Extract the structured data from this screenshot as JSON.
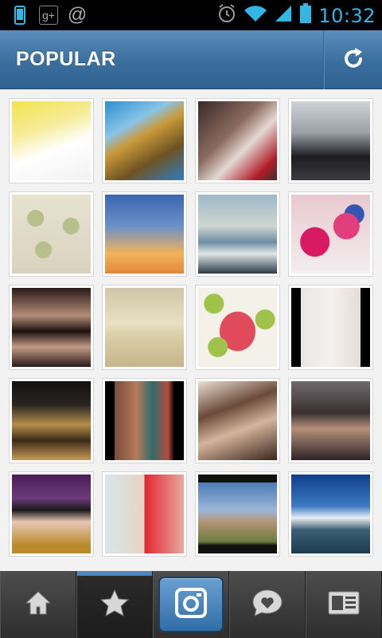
{
  "status_bar": {
    "time": "10:32",
    "icons": [
      "phone-icon",
      "google-plus-icon",
      "at-sign-icon",
      "alarm-icon",
      "wifi-icon",
      "signal-icon",
      "battery-icon"
    ],
    "g_plus_label": "g+",
    "at_label": "@"
  },
  "header": {
    "title": "POPULAR",
    "refresh_icon": "refresh-icon"
  },
  "colors": {
    "header_blue": "#3a6e9c",
    "status_accent": "#33b5e5",
    "active_tab_indicator": "#4a86c0"
  },
  "grid": {
    "photos": [
      {
        "name": "photo-cookie-and-cup",
        "bg": "linear-gradient(160deg,#f3e34a 0%,#f6ec9b 35%,#ffffff 60%,#f1f1f1 100%)"
      },
      {
        "name": "photo-rock-formation",
        "bg": "linear-gradient(150deg,#2b8fd0 0%,#8ac3e6 30%,#c99a3b 45%,#6f5322 70%,#2f7cc4 100%)"
      },
      {
        "name": "photo-two-girls-hugging",
        "bg": "linear-gradient(135deg,#3a2a27 0%,#8a6a5e 40%,#e3d8d2 60%,#b01c2a 85%,#3c2e2c 100%)"
      },
      {
        "name": "photo-three-boys",
        "bg": "linear-gradient(180deg,#cfd3d6 0%,#9aa0a6 40%,#1d1d21 70%,#3a3a3f 100%)"
      },
      {
        "name": "photo-polka-dot-phone",
        "bg": "radial-gradient(circle at 30% 30%,#b7c08a 0 10px,transparent 11px),radial-gradient(circle at 75% 40%,#b7c08a 0 10px,transparent 11px),radial-gradient(circle at 40% 70%,#b7c08a 0 10px,transparent 11px),linear-gradient(#e8e2d0,#d9d2bf)"
      },
      {
        "name": "photo-dandelion-sunset",
        "bg": "linear-gradient(180deg,#3866b0 0%,#6b90c9 40%,#f2b35a 75%,#e1863b 100%)"
      },
      {
        "name": "photo-pier-sunset",
        "bg": "linear-gradient(180deg,#9fb8c9 0%,#cfd6d0 40%,#6c8ea6 60%,#dfe5e6 75%,#2c3b47 100%)"
      },
      {
        "name": "photo-cake-pops",
        "bg": "radial-gradient(circle at 30% 60%,#d81a62 0 18px,transparent 19px),radial-gradient(circle at 70% 40%,#e23d7d 0 16px,transparent 17px),radial-gradient(circle at 80% 25%,#3556b0 0 12px,transparent 13px),linear-gradient(#e8c9cf,#f3eef0)"
      },
      {
        "name": "photo-woman-lying-1",
        "bg": "linear-gradient(180deg,#2b1a18 0%,#b48c78 35%,#1d1110 55%,#c49b86 75%,#2a1a18 100%)"
      },
      {
        "name": "photo-cloudy-field",
        "bg": "linear-gradient(180deg,#cfc7a7 0%,#e8e0c2 45%,#d9cfa8 60%,#c8b48a 100%)"
      },
      {
        "name": "photo-green-dots-pink",
        "bg": "radial-gradient(circle at 20% 20%,#9fc24a 0 12px,transparent 13px),radial-gradient(circle at 85% 40%,#9fc24a 0 12px,transparent 13px),radial-gradient(circle at 25% 75%,#9fc24a 0 12px,transparent 13px),radial-gradient(ellipse at 50% 55%,#e04a5a 0 22px,transparent 23px),linear-gradient(#f4f1e8,#f4f1e8)"
      },
      {
        "name": "photo-two-tattooed-women",
        "bg": "linear-gradient(90deg,#000 0%,#000 12%,#e9e6e3 12%,#f4f2f0 50%,#e4dcd5 88%,#000 88%,#000 100%)"
      },
      {
        "name": "photo-leopard-bag",
        "bg": "linear-gradient(180deg,#111 0%,#2a2522 30%,#b58d4a 55%,#3b2a18 75%,#c79a57 100%)"
      },
      {
        "name": "photo-tattoo-arm",
        "bg": "linear-gradient(90deg,#000 0%,#000 12%,#7a4b3c 12%,#b67a5c 40%,#2f6b6b 60%,#b74a3c 80%,#000 88%,#000 100%)"
      },
      {
        "name": "photo-girl-selfie",
        "bg": "linear-gradient(160deg,#e9dfd0 0%,#6b4a3a 35%,#d6b49c 60%,#3a271e 100%)"
      },
      {
        "name": "photo-woman-dark",
        "bg": "linear-gradient(180deg,#6f6a6c 0%,#3a3032 40%,#b58f7b 60%,#2c2426 100%)"
      },
      {
        "name": "photo-sunglasses-girl",
        "bg": "linear-gradient(180deg,#4a1e57 0%,#6c3a79 30%,#1a1a1a 45%,#e8c7b5 60%,#b88b2d 90%)"
      },
      {
        "name": "photo-collage-faces",
        "bg": "linear-gradient(90deg,#d7e6ea 0%,#e7d4c4 50%,#e1272f 50%,#e7a9a0 100%)"
      },
      {
        "name": "photo-mansion",
        "bg": "linear-gradient(180deg,#111 0%,#111 10%,#4a7ab8 10%,#9cb7d6 45%,#b49377 60%,#6b7d3f 85%,#111 90%,#111 100%)"
      },
      {
        "name": "photo-boat-lake",
        "bg": "linear-gradient(180deg,#0f3f8a 0%,#3c7ac1 40%,#e9eef3 55%,#3b6075 70%,#1b3a4e 100%)"
      }
    ]
  },
  "tabs": [
    {
      "name": "tab-home",
      "icon": "home-icon"
    },
    {
      "name": "tab-popular",
      "icon": "star-icon"
    },
    {
      "name": "tab-camera",
      "icon": "camera-icon"
    },
    {
      "name": "tab-news",
      "icon": "heart-bubble-icon"
    },
    {
      "name": "tab-profile",
      "icon": "profile-card-icon"
    }
  ]
}
